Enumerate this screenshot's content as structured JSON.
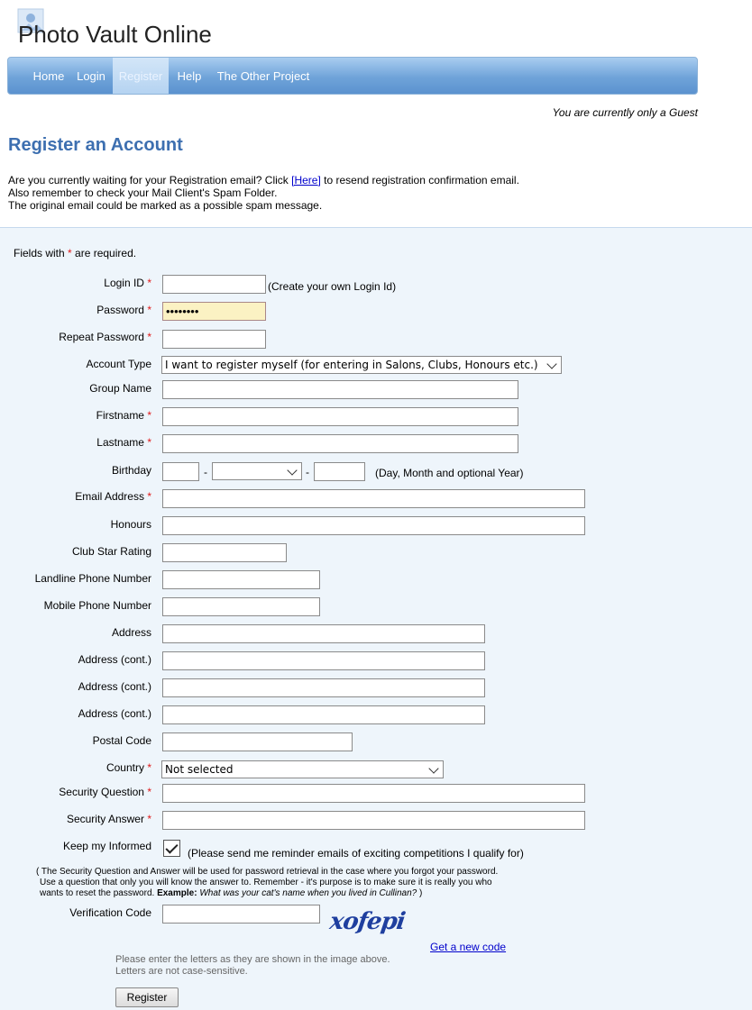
{
  "app": {
    "title": "Photo Vault Online"
  },
  "nav": {
    "items": [
      "Home",
      "Login",
      "Register",
      "Help",
      "The Other Project"
    ],
    "active": "Register"
  },
  "status": {
    "guest_text": "You are currently only a Guest"
  },
  "page": {
    "title": "Register an Account",
    "info_line1_pre": "Are you currently waiting for your Registration email?  Click ",
    "info_link": "[Here]",
    "info_line1_post": " to resend registration confirmation email.",
    "info_line2": "Also remember to check your Mail Client's Spam Folder.",
    "info_line3": "The original email could be marked as a possible spam message."
  },
  "form": {
    "required_note_pre": "Fields with ",
    "required_star": "*",
    "required_note_post": " are required.",
    "login_id": {
      "label": "Login ID",
      "value": "",
      "hint": "(Create your own Login Id)"
    },
    "password": {
      "label": "Password",
      "value": "••••••••"
    },
    "repeat_password": {
      "label": "Repeat Password",
      "value": ""
    },
    "account_type": {
      "label": "Account Type",
      "selected": "I want to register myself (for entering in Salons, Clubs, Honours etc.)"
    },
    "group_name": {
      "label": "Group Name",
      "value": ""
    },
    "firstname": {
      "label": "Firstname",
      "value": ""
    },
    "lastname": {
      "label": "Lastname",
      "value": ""
    },
    "birthday": {
      "label": "Birthday",
      "sep": "-",
      "hint": "(Day, Month and optional Year)"
    },
    "email": {
      "label": "Email Address",
      "value": ""
    },
    "honours": {
      "label": "Honours",
      "value": ""
    },
    "club_star": {
      "label": "Club Star Rating",
      "value": ""
    },
    "landline": {
      "label": "Landline Phone Number",
      "value": ""
    },
    "mobile": {
      "label": "Mobile Phone Number",
      "value": ""
    },
    "address1": {
      "label": "Address",
      "value": ""
    },
    "address2": {
      "label": "Address (cont.)",
      "value": ""
    },
    "address3": {
      "label": "Address (cont.)",
      "value": ""
    },
    "address4": {
      "label": "Address (cont.)",
      "value": ""
    },
    "postal_code": {
      "label": "Postal Code",
      "value": ""
    },
    "country": {
      "label": "Country",
      "selected": "Not selected"
    },
    "security_question": {
      "label": "Security Question",
      "value": ""
    },
    "security_answer": {
      "label": "Security Answer",
      "value": ""
    },
    "keep_informed": {
      "label": "Keep my Informed",
      "hint": "(Please send me reminder emails of exciting competitions I qualify for)",
      "checked": true
    },
    "security_note_1": "( The Security Question and Answer will be used for password retrieval in the case where you forgot your password.",
    "security_note_2": "Use a question that only you will know the answer to. Remember - it's purpose is to make sure it is really you who",
    "security_note_3": "wants to reset the password.",
    "security_note_example_label": "Example:",
    "security_note_example": "What was your cat's name when you lived in Cullinan?",
    "security_note_end": " )",
    "verification": {
      "label": "Verification Code",
      "value": "",
      "captcha_text": "xofepi",
      "new_code": "Get a new code",
      "help1": "Please enter the letters as they are shown in the image above.",
      "help2": "Letters are not case-sensitive."
    },
    "submit_label": "Register"
  }
}
